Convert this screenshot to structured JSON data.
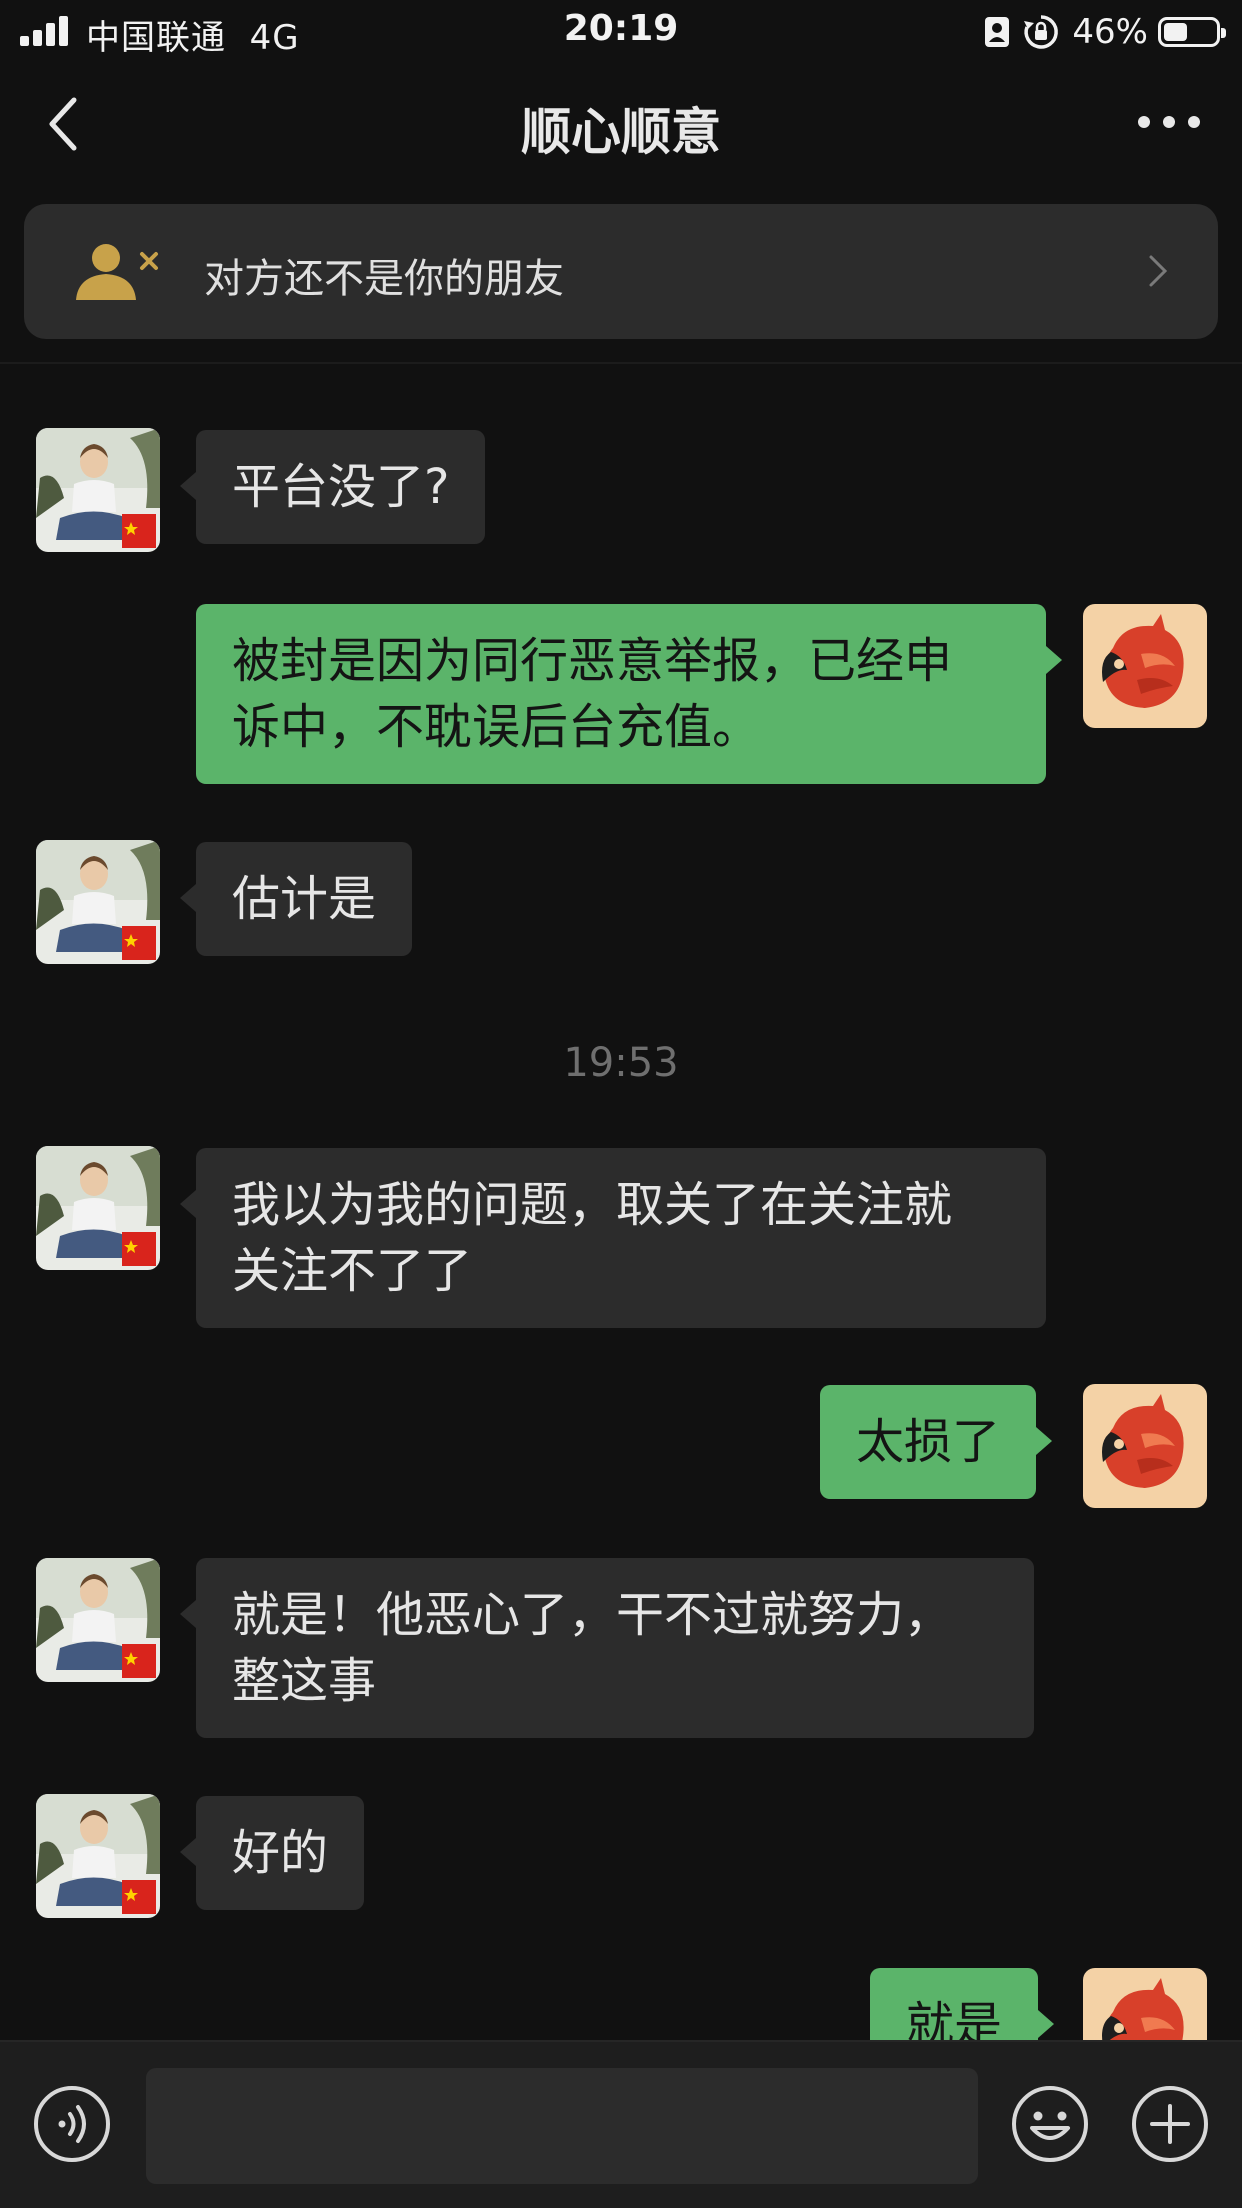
{
  "status_bar": {
    "carrier": "中国联通",
    "network": "4G",
    "time": "20:19",
    "battery_percent": "46%",
    "battery_level": 0.46
  },
  "nav": {
    "title": "顺心顺意",
    "back_icon": "chevron-left-icon",
    "more_icon": "more-dots-icon"
  },
  "banner": {
    "text": "对方还不是你的朋友",
    "icon": "user-remove-icon",
    "arrow_icon": "chevron-right-icon"
  },
  "messages": [
    {
      "side": "in",
      "text": "平台没了?"
    },
    {
      "side": "out",
      "text": "被封是因为同行恶意举报，已经申\n诉中，不耽误后台充值。"
    },
    {
      "side": "in",
      "text": "估计是"
    },
    {
      "side": "in",
      "text": "我以为我的问题，取关了在关注就\n关注不了了"
    },
    {
      "side": "out",
      "text": "太损了"
    },
    {
      "side": "in",
      "text": "就是！他恶心了，干不过就努力，\n整这事"
    },
    {
      "side": "in",
      "text": "好的"
    },
    {
      "side": "out",
      "text": "就是"
    }
  ],
  "timestamp": "19:53",
  "input_bar": {
    "voice_icon": "voice-icon",
    "emoji_icon": "emoji-icon",
    "plus_icon": "plus-icon"
  },
  "colors": {
    "background": "#111111",
    "incoming_bubble": "#2c2c2c",
    "outgoing_bubble": "#5bb46a",
    "banner_icon": "#c8a24a"
  }
}
